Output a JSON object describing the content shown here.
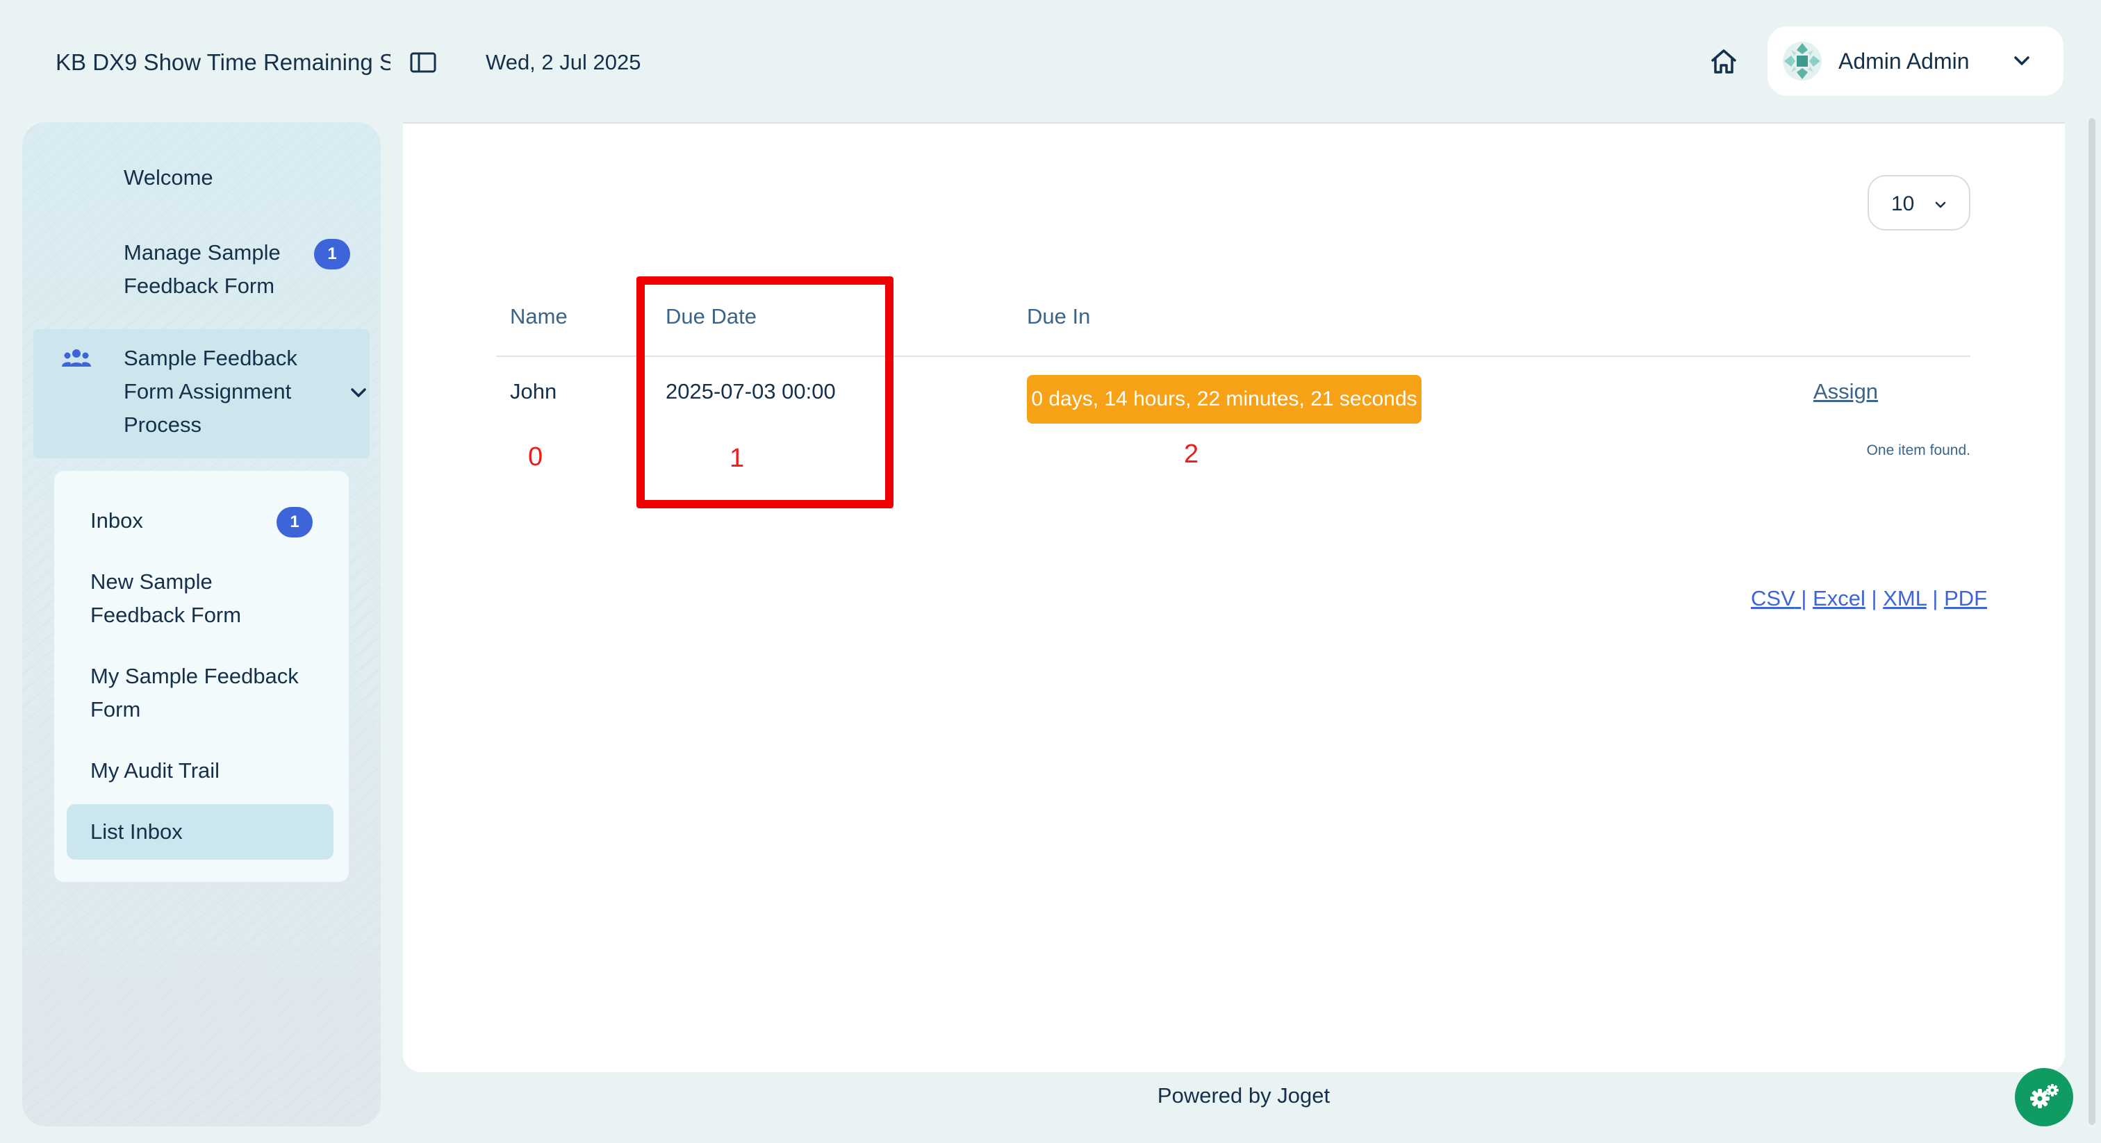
{
  "header": {
    "app_title": "KB DX9 Show Time Remaining S",
    "date": "Wed, 2 Jul 2025",
    "user_name": "Admin Admin"
  },
  "sidebar": {
    "welcome": "Welcome",
    "manage_line1": "Manage Sample",
    "manage_line2": "Feedback Form",
    "manage_badge": "1",
    "process_line1": "Sample Feedback",
    "process_line2": "Form Assignment",
    "process_line3": "Process",
    "subitems": {
      "inbox": "Inbox",
      "inbox_badge": "1",
      "new_form_line1": "New Sample",
      "new_form_line2": "Feedback Form",
      "my_form_line1": "My Sample Feedback",
      "my_form_line2": "Form",
      "audit_trail": "My Audit Trail",
      "list_inbox": "List Inbox"
    }
  },
  "table": {
    "page_size": "10",
    "columns": [
      "Name",
      "Due Date",
      "Due In"
    ],
    "rows": [
      {
        "name": "John",
        "due_date": "2025-07-03 00:00",
        "due_in": "0 days, 14 hours, 22 minutes, 21 seconds",
        "action": "Assign"
      }
    ],
    "result_text": "One item found."
  },
  "annotations": {
    "markers": [
      "0",
      "1",
      "2"
    ],
    "highlight_color": "#f00000"
  },
  "export": {
    "csv": "CSV",
    "excel": "Excel",
    "xml": "XML",
    "pdf": "PDF",
    "separator": "|"
  },
  "footer": {
    "powered_by": "Powered by Joget"
  },
  "colors": {
    "background": "#eaf3f4",
    "badge": "#3d64d8",
    "due_in_badge": "#f7a116",
    "fab": "#0f9b62",
    "text": "#14304a"
  },
  "icons": [
    "sidebar-toggle-icon",
    "home-icon",
    "avatar-logo-icon",
    "chevron-down-icon",
    "users-group-icon",
    "gears-icon"
  ]
}
